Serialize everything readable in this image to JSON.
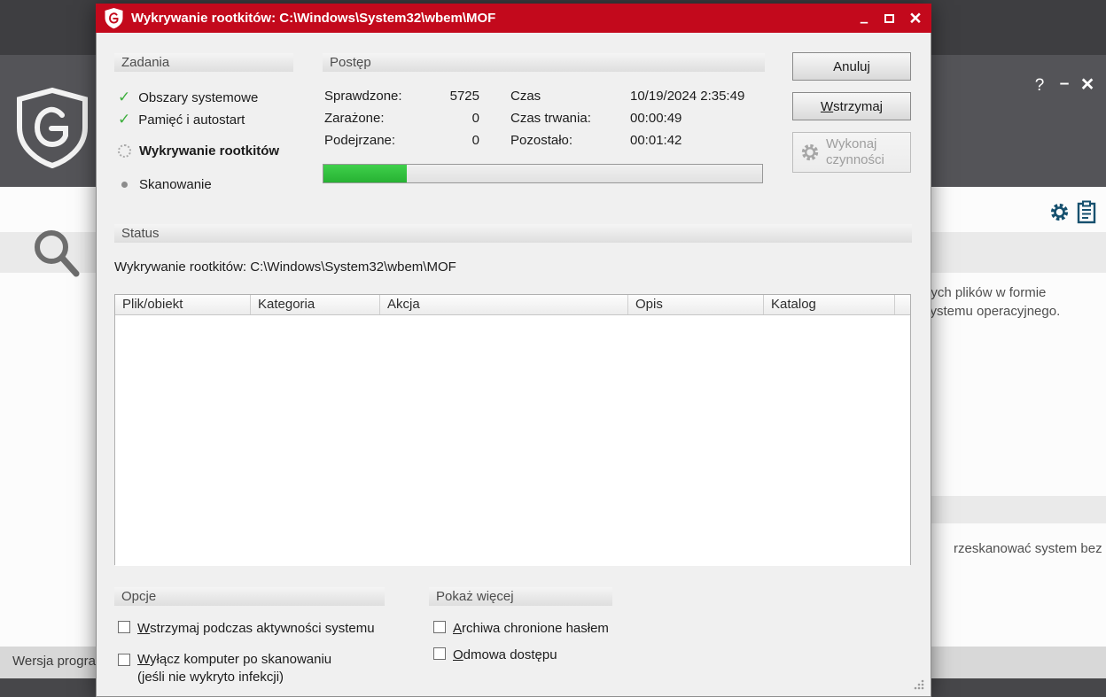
{
  "colors": {
    "titlebar_red": "#c3091c",
    "progress_green": "#2dc937",
    "check_green": "#3daf3d",
    "accent_blue": "#16506e"
  },
  "background": {
    "help": "?",
    "minimize": "–",
    "close": "×",
    "text_top_1": "nych plików w formie",
    "text_top_2": "systemu operacyjnego.",
    "text_bottom": "rzeskanować system bez",
    "statusbar": "Wersja progra"
  },
  "dialog": {
    "title": "Wykrywanie rootkitów: C:\\Windows\\System32\\wbem\\MOF",
    "controls": {
      "minimize": "–",
      "close": "×"
    },
    "tasks": {
      "header": "Zadania",
      "items": [
        {
          "label": "Obszary systemowe",
          "state": "done"
        },
        {
          "label": "Pamięć i autostart",
          "state": "done"
        },
        {
          "label": "Wykrywanie rootkitów",
          "state": "active"
        },
        {
          "label": "Skanowanie",
          "state": "pending"
        }
      ]
    },
    "progress": {
      "header": "Postęp",
      "percent": 19,
      "left": [
        {
          "label": "Sprawdzone:",
          "value": "5725"
        },
        {
          "label": "Zarażone:",
          "value": "0"
        },
        {
          "label": "Podejrzane:",
          "value": "0"
        }
      ],
      "right": [
        {
          "label": "Czas",
          "value": "10/19/2024 2:35:49"
        },
        {
          "label": "Czas trwania:",
          "value": "00:00:49"
        },
        {
          "label": "Pozostało:",
          "value": "00:01:42"
        }
      ]
    },
    "buttons": {
      "cancel": {
        "label": "Anuluj"
      },
      "pause": {
        "mnemonic": "W",
        "rest": "strzymaj"
      },
      "execute": {
        "line1": "Wykonaj",
        "line2": "czynności"
      }
    },
    "status": {
      "header": "Status",
      "text": "Wykrywanie rootkitów: C:\\Windows\\System32\\wbem\\MOF"
    },
    "results": {
      "columns": [
        "Plik/obiekt",
        "Kategoria",
        "Akcja",
        "Opis",
        "Katalog"
      ]
    },
    "options": {
      "header": "Opcje",
      "cb_pause": {
        "mnemonic": "W",
        "rest": "strzymaj  podczas aktywności systemu"
      },
      "cb_shutdown": {
        "mnemonic": "W",
        "rest": "yłącz komputer po skanowaniu",
        "line2": "(jeśli nie wykryto infekcji)"
      }
    },
    "show_more": {
      "header": "Pokaż więcej",
      "cb_archives": {
        "mnemonic": "A",
        "rest": "rchiwa chronione hasłem"
      },
      "cb_denied": {
        "mnemonic": "O",
        "rest": "dmowa dostępu"
      }
    }
  }
}
